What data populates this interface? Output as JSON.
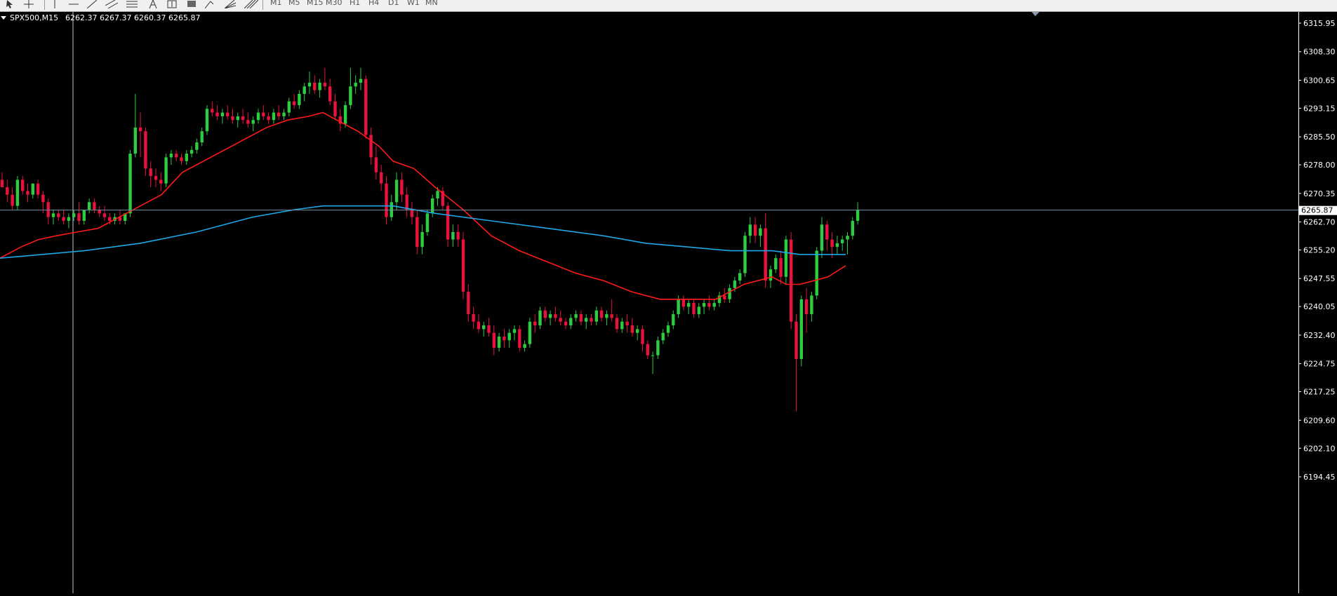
{
  "toolbar": {
    "timeframes": [
      "M1",
      "M5",
      "M15",
      "M30",
      "H1",
      "H4",
      "D1",
      "W1",
      "MN"
    ],
    "tools": [
      "cursor-icon",
      "crosshair-icon",
      "vertical-line-icon",
      "horizontal-line-icon",
      "trendline-icon",
      "equidistant-channel-icon",
      "fibonacci-retracement-icon",
      "text-icon",
      "text-label-icon",
      "rectangle-icon",
      "arrow-icon",
      "gann-fan-icon",
      "andrews-pitchfork-icon"
    ]
  },
  "chart_header": {
    "symbol": "SPX500,M15",
    "ohlc": "6262.37 6267.37 6260.37 6265.87"
  },
  "current_price_label": "6265.87",
  "colors": {
    "background": "#000000",
    "bull": "#2ecc40",
    "bear": "#e8123c",
    "ma_fast": "#ff1a1a",
    "ma_slow": "#1ea6e8",
    "price_line": "#6f8fa5",
    "crosshair": "#c8c8c8",
    "axis_text": "#ffffff"
  },
  "chart_data": {
    "type": "candlestick",
    "symbol": "SPX500",
    "timeframe": "M15",
    "ylim": [
      6194.45,
      6315.95
    ],
    "y_ticks": [
      "6315.95",
      "6308.30",
      "6300.65",
      "6293.15",
      "6285.50",
      "6278.00",
      "6270.35",
      "6262.70",
      "6255.20",
      "6247.55",
      "6240.05",
      "6232.40",
      "6224.75",
      "6217.25",
      "6209.60",
      "6202.10",
      "6194.45"
    ],
    "last_price": 6265.87,
    "candles": [
      [
        6274,
        6276,
        6272,
        6272
      ],
      [
        6272,
        6274,
        6268,
        6270
      ],
      [
        6270,
        6272,
        6266,
        6267
      ],
      [
        6267,
        6275,
        6266,
        6274
      ],
      [
        6274,
        6275,
        6270,
        6271
      ],
      [
        6271,
        6273,
        6268,
        6270
      ],
      [
        6270,
        6273,
        6269,
        6273
      ],
      [
        6273,
        6274,
        6269,
        6270
      ],
      [
        6270,
        6271,
        6265,
        6268
      ],
      [
        6268,
        6269,
        6262,
        6264
      ],
      [
        6264,
        6266,
        6262,
        6265
      ],
      [
        6265,
        6266,
        6263,
        6264
      ],
      [
        6264,
        6266,
        6262,
        6263
      ],
      [
        6263,
        6265,
        6261,
        6264
      ],
      [
        6264,
        6266,
        6263,
        6265
      ],
      [
        6265,
        6268,
        6262,
        6263
      ],
      [
        6263,
        6266,
        6262,
        6266
      ],
      [
        6266,
        6269,
        6265,
        6268
      ],
      [
        6268,
        6269,
        6265,
        6266
      ],
      [
        6266,
        6267,
        6264,
        6265
      ],
      [
        6265,
        6267,
        6263,
        6264
      ],
      [
        6264,
        6265,
        6262,
        6263
      ],
      [
        6263,
        6265,
        6262,
        6264
      ],
      [
        6264,
        6266,
        6262,
        6263
      ],
      [
        6263,
        6265,
        6262,
        6265
      ],
      [
        6265,
        6282,
        6264,
        6281
      ],
      [
        6281,
        6297,
        6280,
        6288
      ],
      [
        6288,
        6292,
        6280,
        6287
      ],
      [
        6287,
        6288,
        6275,
        6277
      ],
      [
        6277,
        6279,
        6272,
        6275
      ],
      [
        6275,
        6277,
        6272,
        6274
      ],
      [
        6274,
        6276,
        6271,
        6273
      ],
      [
        6273,
        6281,
        6272,
        6280
      ],
      [
        6280,
        6282,
        6278,
        6281
      ],
      [
        6281,
        6282,
        6279,
        6280
      ],
      [
        6280,
        6281,
        6278,
        6279
      ],
      [
        6279,
        6282,
        6278,
        6281
      ],
      [
        6281,
        6283,
        6280,
        6282
      ],
      [
        6282,
        6285,
        6281,
        6284
      ],
      [
        6284,
        6288,
        6283,
        6287
      ],
      [
        6287,
        6294,
        6286,
        6293
      ],
      [
        6293,
        6295,
        6291,
        6292
      ],
      [
        6292,
        6294,
        6290,
        6291
      ],
      [
        6291,
        6293,
        6289,
        6292
      ],
      [
        6292,
        6294,
        6290,
        6291
      ],
      [
        6291,
        6293,
        6289,
        6290
      ],
      [
        6290,
        6292,
        6288,
        6291
      ],
      [
        6291,
        6293,
        6289,
        6290
      ],
      [
        6290,
        6292,
        6288,
        6289
      ],
      [
        6289,
        6291,
        6287,
        6290
      ],
      [
        6290,
        6293,
        6289,
        6292
      ],
      [
        6292,
        6294,
        6290,
        6291
      ],
      [
        6291,
        6292,
        6289,
        6290
      ],
      [
        6290,
        6293,
        6289,
        6292
      ],
      [
        6292,
        6294,
        6290,
        6291
      ],
      [
        6291,
        6293,
        6290,
        6292
      ],
      [
        6292,
        6296,
        6291,
        6295
      ],
      [
        6295,
        6297,
        6293,
        6294
      ],
      [
        6294,
        6298,
        6293,
        6297
      ],
      [
        6297,
        6300,
        6295,
        6299
      ],
      [
        6299,
        6303,
        6297,
        6300
      ],
      [
        6300,
        6302,
        6297,
        6298
      ],
      [
        6298,
        6301,
        6296,
        6300
      ],
      [
        6300,
        6304,
        6298,
        6299
      ],
      [
        6299,
        6301,
        6294,
        6295
      ],
      [
        6295,
        6297,
        6290,
        6291
      ],
      [
        6291,
        6293,
        6287,
        6289
      ],
      [
        6289,
        6295,
        6288,
        6294
      ],
      [
        6294,
        6304,
        6293,
        6299
      ],
      [
        6299,
        6302,
        6297,
        6300
      ],
      [
        6300,
        6304,
        6298,
        6301
      ],
      [
        6301,
        6302,
        6285,
        6286
      ],
      [
        6286,
        6288,
        6278,
        6280
      ],
      [
        6280,
        6283,
        6274,
        6276
      ],
      [
        6276,
        6278,
        6271,
        6273
      ],
      [
        6273,
        6275,
        6262,
        6264
      ],
      [
        6264,
        6270,
        6263,
        6268
      ],
      [
        6268,
        6276,
        6266,
        6274
      ],
      [
        6274,
        6276,
        6268,
        6270
      ],
      [
        6270,
        6272,
        6264,
        6266
      ],
      [
        6266,
        6268,
        6262,
        6264
      ],
      [
        6264,
        6266,
        6254,
        6256
      ],
      [
        6256,
        6262,
        6254,
        6260
      ],
      [
        6260,
        6266,
        6259,
        6265
      ],
      [
        6265,
        6270,
        6264,
        6269
      ],
      [
        6269,
        6272,
        6267,
        6271
      ],
      [
        6271,
        6272,
        6266,
        6267
      ],
      [
        6267,
        6268,
        6256,
        6258
      ],
      [
        6258,
        6262,
        6256,
        6260
      ],
      [
        6260,
        6262,
        6256,
        6258
      ],
      [
        6258,
        6260,
        6242,
        6244
      ],
      [
        6244,
        6246,
        6236,
        6238
      ],
      [
        6238,
        6240,
        6234,
        6236
      ],
      [
        6236,
        6238,
        6233,
        6234
      ],
      [
        6234,
        6236,
        6232,
        6235
      ],
      [
        6235,
        6237,
        6232,
        6233
      ],
      [
        6233,
        6235,
        6227,
        6229
      ],
      [
        6229,
        6233,
        6228,
        6232
      ],
      [
        6232,
        6234,
        6229,
        6231
      ],
      [
        6231,
        6234,
        6229,
        6233
      ],
      [
        6233,
        6235,
        6231,
        6234
      ],
      [
        6234,
        6235,
        6228,
        6229
      ],
      [
        6229,
        6231,
        6228,
        6230
      ],
      [
        6230,
        6237,
        6229,
        6236
      ],
      [
        6236,
        6238,
        6233,
        6235
      ],
      [
        6235,
        6240,
        6234,
        6239
      ],
      [
        6239,
        6240,
        6236,
        6237
      ],
      [
        6237,
        6239,
        6235,
        6238
      ],
      [
        6238,
        6240,
        6236,
        6237
      ],
      [
        6237,
        6239,
        6235,
        6236
      ],
      [
        6236,
        6237,
        6234,
        6235
      ],
      [
        6235,
        6238,
        6234,
        6237
      ],
      [
        6237,
        6239,
        6236,
        6238
      ],
      [
        6238,
        6239,
        6235,
        6236
      ],
      [
        6236,
        6238,
        6234,
        6237
      ],
      [
        6237,
        6238,
        6235,
        6236
      ],
      [
        6236,
        6240,
        6235,
        6239
      ],
      [
        6239,
        6240,
        6236,
        6237
      ],
      [
        6237,
        6239,
        6235,
        6238
      ],
      [
        6238,
        6242,
        6236,
        6237
      ],
      [
        6237,
        6238,
        6233,
        6234
      ],
      [
        6234,
        6237,
        6233,
        6236
      ],
      [
        6236,
        6238,
        6233,
        6235
      ],
      [
        6235,
        6237,
        6232,
        6233
      ],
      [
        6233,
        6235,
        6231,
        6234
      ],
      [
        6234,
        6235,
        6228,
        6230
      ],
      [
        6230,
        6231,
        6226,
        6227
      ],
      [
        6227,
        6228,
        6222,
        6227
      ],
      [
        6227,
        6232,
        6226,
        6231
      ],
      [
        6231,
        6234,
        6230,
        6233
      ],
      [
        6233,
        6236,
        6232,
        6235
      ],
      [
        6235,
        6239,
        6234,
        6238
      ],
      [
        6238,
        6243,
        6237,
        6242
      ],
      [
        6242,
        6243,
        6239,
        6240
      ],
      [
        6240,
        6242,
        6238,
        6241
      ],
      [
        6241,
        6242,
        6237,
        6238
      ],
      [
        6238,
        6241,
        6237,
        6240
      ],
      [
        6240,
        6242,
        6238,
        6241
      ],
      [
        6241,
        6243,
        6239,
        6240
      ],
      [
        6240,
        6242,
        6239,
        6241
      ],
      [
        6241,
        6244,
        6240,
        6243
      ],
      [
        6243,
        6245,
        6241,
        6242
      ],
      [
        6242,
        6246,
        6241,
        6245
      ],
      [
        6245,
        6248,
        6244,
        6247
      ],
      [
        6247,
        6250,
        6246,
        6249
      ],
      [
        6249,
        6260,
        6248,
        6259
      ],
      [
        6259,
        6264,
        6257,
        6262
      ],
      [
        6262,
        6264,
        6257,
        6259
      ],
      [
        6259,
        6262,
        6256,
        6261
      ],
      [
        6261,
        6265,
        6245,
        6247
      ],
      [
        6247,
        6251,
        6245,
        6250
      ],
      [
        6250,
        6254,
        6249,
        6253
      ],
      [
        6253,
        6255,
        6246,
        6248
      ],
      [
        6248,
        6259,
        6246,
        6258
      ],
      [
        6258,
        6260,
        6234,
        6236
      ],
      [
        6236,
        6238,
        6212,
        6226
      ],
      [
        6226,
        6243,
        6224,
        6242
      ],
      [
        6242,
        6245,
        6233,
        6238
      ],
      [
        6238,
        6244,
        6236,
        6243
      ],
      [
        6243,
        6256,
        6242,
        6255
      ],
      [
        6255,
        6264,
        6253,
        6262
      ],
      [
        6262,
        6263,
        6255,
        6258
      ],
      [
        6258,
        6260,
        6253,
        6256
      ],
      [
        6256,
        6259,
        6254,
        6257
      ],
      [
        6257,
        6259,
        6255,
        6258
      ],
      [
        6258,
        6260,
        6254,
        6259
      ],
      [
        6259,
        6264,
        6258,
        6263
      ],
      [
        6263,
        6268,
        6262,
        6266
      ]
    ],
    "series": [
      {
        "name": "",
        "color": "#ff1a1a",
        "values": [
          [
            0,
            6253
          ],
          [
            30,
            6256
          ],
          [
            55,
            6258
          ],
          [
            80,
            6259
          ],
          [
            110,
            6260
          ],
          [
            140,
            6261
          ],
          [
            170,
            6264
          ],
          [
            200,
            6267
          ],
          [
            230,
            6270
          ],
          [
            260,
            6276
          ],
          [
            290,
            6279
          ],
          [
            320,
            6282
          ],
          [
            350,
            6285
          ],
          [
            380,
            6288
          ],
          [
            410,
            6290
          ],
          [
            440,
            6291
          ],
          [
            460,
            6292
          ],
          [
            480,
            6290
          ],
          [
            510,
            6287
          ],
          [
            540,
            6283
          ],
          [
            560,
            6279
          ],
          [
            590,
            6277
          ],
          [
            620,
            6272
          ],
          [
            660,
            6266
          ],
          [
            700,
            6259
          ],
          [
            740,
            6255
          ],
          [
            780,
            6252
          ],
          [
            820,
            6249
          ],
          [
            860,
            6247
          ],
          [
            900,
            6244
          ],
          [
            940,
            6242
          ],
          [
            980,
            6242
          ],
          [
            1020,
            6242
          ],
          [
            1040,
            6244
          ],
          [
            1060,
            6246
          ],
          [
            1080,
            6247
          ],
          [
            1100,
            6248
          ],
          [
            1120,
            6246
          ],
          [
            1140,
            6246
          ],
          [
            1160,
            6247
          ],
          [
            1180,
            6248
          ],
          [
            1205,
            6251
          ]
        ]
      },
      {
        "name": "",
        "color": "#1ea6e8",
        "values": [
          [
            0,
            6253
          ],
          [
            60,
            6254
          ],
          [
            120,
            6255
          ],
          [
            200,
            6257
          ],
          [
            280,
            6260
          ],
          [
            360,
            6264
          ],
          [
            420,
            6266
          ],
          [
            460,
            6267
          ],
          [
            500,
            6267
          ],
          [
            560,
            6267
          ],
          [
            620,
            6265
          ],
          [
            700,
            6263
          ],
          [
            780,
            6261
          ],
          [
            860,
            6259
          ],
          [
            920,
            6257
          ],
          [
            980,
            6256
          ],
          [
            1040,
            6255
          ],
          [
            1100,
            6255
          ],
          [
            1140,
            6254
          ],
          [
            1170,
            6254
          ],
          [
            1205,
            6254
          ]
        ]
      }
    ]
  }
}
